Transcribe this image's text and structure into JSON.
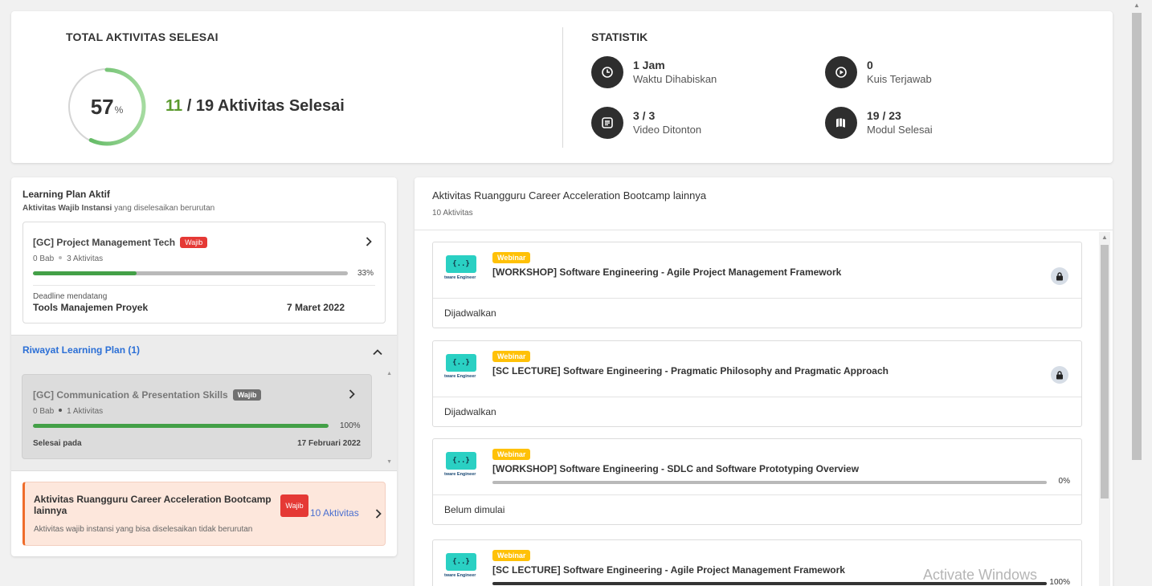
{
  "summary": {
    "total_title": "TOTAL AKTIVITAS SELESAI",
    "percent": "57",
    "percent_sign": "%",
    "progress_fraction": 0.57,
    "done": "11",
    "total_text": " / 19 Aktivitas Selesai"
  },
  "stats": {
    "title": "STATISTIK",
    "items": [
      {
        "value": "1 Jam",
        "label": "Waktu Dihabiskan",
        "icon": "clock-icon"
      },
      {
        "value": "0",
        "label": "Kuis Terjawab",
        "icon": "play-circle-icon"
      },
      {
        "value": "3 / 3",
        "label": "Video Ditonton",
        "icon": "list-icon"
      },
      {
        "value": "19 / 23",
        "label": "Modul Selesai",
        "icon": "book-icon"
      }
    ]
  },
  "learning_plan": {
    "title": "Learning Plan Aktif",
    "subtitle_bold": "Aktivitas Wajib Instansi",
    "subtitle_rest": " yang diselesaikan berurutan",
    "active": {
      "name": "[GC] Project Management Tech",
      "badge": "Wajib",
      "bab": "0 Bab",
      "aktivitas": "3 Aktivitas",
      "progress": 0.33,
      "percent_label": "33%",
      "deadline_label": "Deadline mendatang",
      "deadline_name": "Tools Manajemen Proyek",
      "deadline_date": "7 Maret 2022"
    },
    "history": {
      "title": "Riwayat Learning Plan (1)",
      "item": {
        "name": "[GC] Communication & Presentation Skills",
        "badge": "Wajib",
        "bab": "0 Bab",
        "aktivitas": "1 Aktivitas",
        "progress": 1.0,
        "percent_label": "100%",
        "done_label": "Selesai pada",
        "done_date": "17 Februari 2022"
      }
    },
    "other": {
      "title": "Aktivitas Ruangguru Career Acceleration Bootcamp lainnya",
      "badge": "Wajib",
      "count": "10 Aktivitas",
      "desc": "Aktivitas wajib instansi yang bisa diselesaikan tidak berurutan"
    }
  },
  "activities": {
    "title": "Aktivitas Ruangguru Career Acceleration Bootcamp lainnya",
    "count": "10 Aktivitas",
    "thumb_text": "{..}",
    "thumb_caption": "tware Engineer",
    "items": [
      {
        "type": "Webinar",
        "name": "[WORKSHOP] Software Engineering - Agile Project Management Framework",
        "status": "Dijadwalkan",
        "locked": true
      },
      {
        "type": "Webinar",
        "name": "[SC LECTURE] Software Engineering - Pragmatic Philosophy and Pragmatic Approach",
        "status": "Dijadwalkan",
        "locked": true
      },
      {
        "type": "Webinar",
        "name": "[WORKSHOP] Software Engineering - SDLC and Software Prototyping Overview",
        "status": "Belum dimulai",
        "progress": 0.0,
        "percent_label": "0%"
      },
      {
        "type": "Webinar",
        "name": "[SC LECTURE] Software Engineering - Agile Project Management Framework",
        "status": "",
        "progress": 1.0,
        "percent_label": "100%"
      }
    ]
  },
  "watermark": "Activate Windows",
  "colors": {
    "accent_green": "#43a047",
    "badge_red": "#e53935",
    "webinar_yellow": "#ffc107",
    "link_blue": "#2b6fd6"
  }
}
